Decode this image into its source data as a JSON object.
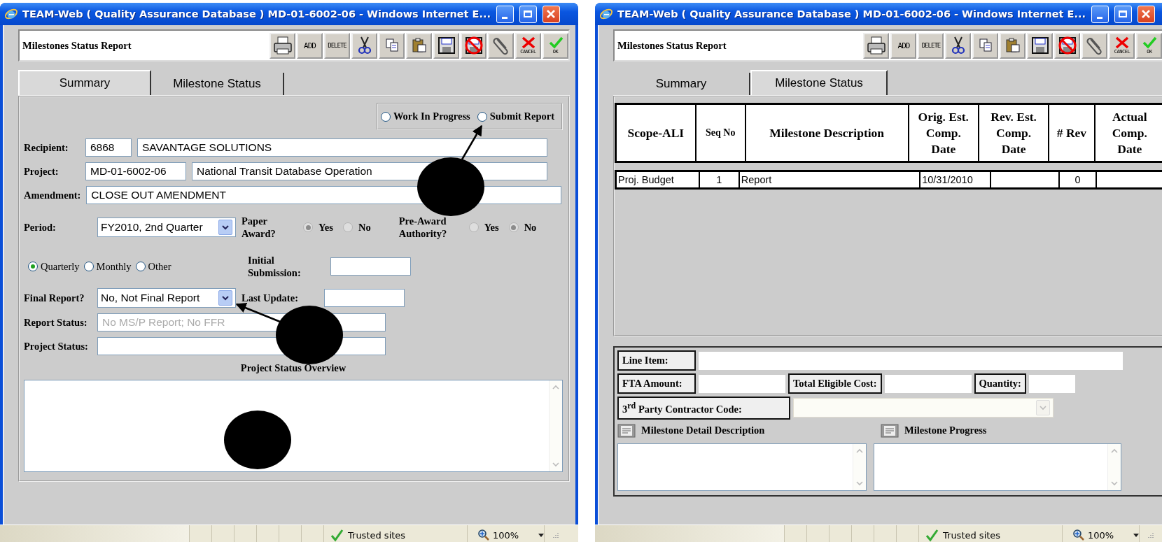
{
  "windows": [
    {
      "kind": "summary",
      "title": "TEAM-Web ( Quality Assurance Database ) MD-01-6002-06 - Windows Internet E...",
      "form_title": "Milestones Status Report",
      "toolbar": [
        {
          "kind": "print"
        },
        {
          "kind": "add",
          "label": "ADD"
        },
        {
          "kind": "delete",
          "label": "DELETE"
        },
        {
          "kind": "cut"
        },
        {
          "kind": "copy"
        },
        {
          "kind": "paste"
        },
        {
          "kind": "save"
        },
        {
          "kind": "nosave"
        },
        {
          "kind": "attach"
        },
        {
          "kind": "cancel",
          "label": "CANCEL"
        },
        {
          "kind": "ok",
          "label": "OK"
        }
      ],
      "tabs": [
        {
          "label": "Summary",
          "selected": true
        },
        {
          "label": "Milestone Status",
          "selected": false
        }
      ],
      "report_mode": [
        {
          "label": "Work In Progress",
          "selected": false
        },
        {
          "label": "Submit Report",
          "selected": false
        }
      ],
      "recipient": {
        "label": "Recipient:",
        "code": "6868",
        "name": "SAVANTAGE SOLUTIONS"
      },
      "project": {
        "label": "Project:",
        "code": "MD-01-6002-06",
        "name": "National Transit Database Operation"
      },
      "amendment": {
        "label": "Amendment:",
        "value": "CLOSE OUT AMENDMENT"
      },
      "period": {
        "label": "Period:",
        "value": "FY2010, 2nd Quarter"
      },
      "paper_award": {
        "label": "Paper Award?",
        "disabled": true,
        "options": [
          {
            "label": "Yes",
            "selected": true
          },
          {
            "label": "No",
            "selected": false
          }
        ]
      },
      "pre_award_authority": {
        "label": "Pre-Award Authority?",
        "disabled": true,
        "options": [
          {
            "label": "Yes",
            "selected": false
          },
          {
            "label": "No",
            "selected": true
          }
        ]
      },
      "frequency": [
        {
          "label": "Quarterly",
          "selected": true
        },
        {
          "label": "Monthly",
          "selected": false
        },
        {
          "label": "Other",
          "selected": false
        }
      ],
      "initial_submission": {
        "label": "Initial Submission:"
      },
      "final_report": {
        "label": "Final Report?",
        "value": "No, Not Final Report"
      },
      "last_update": {
        "label": "Last Update:"
      },
      "report_status": {
        "label": "Report Status:",
        "value": "No MS/P Report; No FFR",
        "disabled": true
      },
      "project_status": {
        "label": "Project Status:"
      },
      "overview": {
        "label": "Project Status Overview"
      },
      "status_bar": {
        "zone": "Trusted sites",
        "zoom": "100%"
      }
    },
    {
      "kind": "milestones",
      "title": "TEAM-Web ( Quality Assurance Database ) MD-01-6002-06 - Windows Internet E...",
      "form_title": "Milestones Status Report",
      "toolbar": [
        {
          "kind": "print"
        },
        {
          "kind": "add",
          "label": "ADD"
        },
        {
          "kind": "delete",
          "label": "DELETE"
        },
        {
          "kind": "cut"
        },
        {
          "kind": "copy"
        },
        {
          "kind": "paste"
        },
        {
          "kind": "save"
        },
        {
          "kind": "nosave"
        },
        {
          "kind": "attach"
        },
        {
          "kind": "cancel",
          "label": "CANCEL"
        },
        {
          "kind": "ok",
          "label": "OK"
        }
      ],
      "tabs": [
        {
          "label": "Summary",
          "selected": false
        },
        {
          "label": "Milestone Status",
          "selected": true
        }
      ],
      "table": {
        "columns": [
          "Scope-ALI",
          "Seq No",
          "Milestone Description",
          "Orig. Est. Comp. Date",
          "Rev. Est. Comp. Date",
          "# Rev",
          "Actual Comp. Date"
        ],
        "rows": [
          {
            "scope": "Proj. Budget",
            "seq": "1",
            "description": "Report",
            "orig_date": "10/31/2010",
            "rev_count": "0"
          }
        ]
      },
      "detail": {
        "line_item": "Line Item:",
        "fta_amount": "FTA Amount:",
        "total_cost": "Total Eligible Cost:",
        "quantity": "Quantity:",
        "contractor_code": "3$^{rd}$ Party Contractor Code:",
        "detail_description": "Milestone Detail Description",
        "progress": "Milestone Progress"
      },
      "status_bar": {
        "zone": "Trusted sites",
        "zoom": "100%"
      }
    }
  ]
}
